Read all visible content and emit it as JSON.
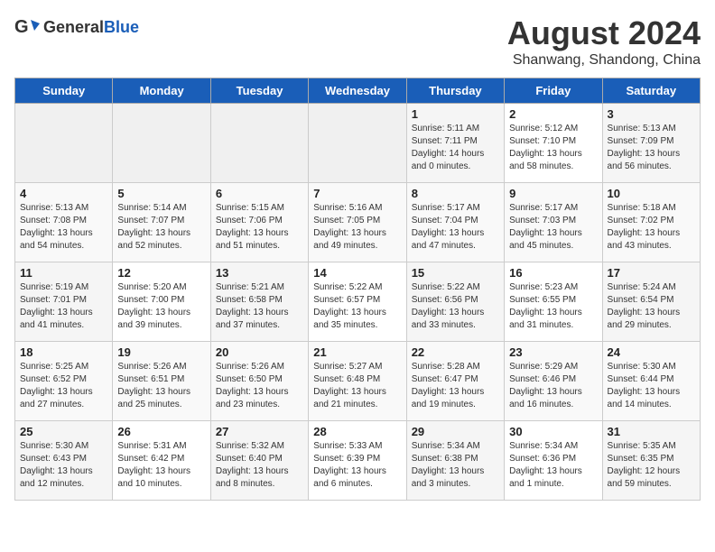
{
  "header": {
    "logo": {
      "general": "General",
      "blue": "Blue"
    },
    "title": "August 2024",
    "subtitle": "Shanwang, Shandong, China"
  },
  "weekdays": [
    "Sunday",
    "Monday",
    "Tuesday",
    "Wednesday",
    "Thursday",
    "Friday",
    "Saturday"
  ],
  "weeks": [
    [
      {
        "day": "",
        "info": ""
      },
      {
        "day": "",
        "info": ""
      },
      {
        "day": "",
        "info": ""
      },
      {
        "day": "",
        "info": ""
      },
      {
        "day": "1",
        "info": "Sunrise: 5:11 AM\nSunset: 7:11 PM\nDaylight: 14 hours\nand 0 minutes."
      },
      {
        "day": "2",
        "info": "Sunrise: 5:12 AM\nSunset: 7:10 PM\nDaylight: 13 hours\nand 58 minutes."
      },
      {
        "day": "3",
        "info": "Sunrise: 5:13 AM\nSunset: 7:09 PM\nDaylight: 13 hours\nand 56 minutes."
      }
    ],
    [
      {
        "day": "4",
        "info": "Sunrise: 5:13 AM\nSunset: 7:08 PM\nDaylight: 13 hours\nand 54 minutes."
      },
      {
        "day": "5",
        "info": "Sunrise: 5:14 AM\nSunset: 7:07 PM\nDaylight: 13 hours\nand 52 minutes."
      },
      {
        "day": "6",
        "info": "Sunrise: 5:15 AM\nSunset: 7:06 PM\nDaylight: 13 hours\nand 51 minutes."
      },
      {
        "day": "7",
        "info": "Sunrise: 5:16 AM\nSunset: 7:05 PM\nDaylight: 13 hours\nand 49 minutes."
      },
      {
        "day": "8",
        "info": "Sunrise: 5:17 AM\nSunset: 7:04 PM\nDaylight: 13 hours\nand 47 minutes."
      },
      {
        "day": "9",
        "info": "Sunrise: 5:17 AM\nSunset: 7:03 PM\nDaylight: 13 hours\nand 45 minutes."
      },
      {
        "day": "10",
        "info": "Sunrise: 5:18 AM\nSunset: 7:02 PM\nDaylight: 13 hours\nand 43 minutes."
      }
    ],
    [
      {
        "day": "11",
        "info": "Sunrise: 5:19 AM\nSunset: 7:01 PM\nDaylight: 13 hours\nand 41 minutes."
      },
      {
        "day": "12",
        "info": "Sunrise: 5:20 AM\nSunset: 7:00 PM\nDaylight: 13 hours\nand 39 minutes."
      },
      {
        "day": "13",
        "info": "Sunrise: 5:21 AM\nSunset: 6:58 PM\nDaylight: 13 hours\nand 37 minutes."
      },
      {
        "day": "14",
        "info": "Sunrise: 5:22 AM\nSunset: 6:57 PM\nDaylight: 13 hours\nand 35 minutes."
      },
      {
        "day": "15",
        "info": "Sunrise: 5:22 AM\nSunset: 6:56 PM\nDaylight: 13 hours\nand 33 minutes."
      },
      {
        "day": "16",
        "info": "Sunrise: 5:23 AM\nSunset: 6:55 PM\nDaylight: 13 hours\nand 31 minutes."
      },
      {
        "day": "17",
        "info": "Sunrise: 5:24 AM\nSunset: 6:54 PM\nDaylight: 13 hours\nand 29 minutes."
      }
    ],
    [
      {
        "day": "18",
        "info": "Sunrise: 5:25 AM\nSunset: 6:52 PM\nDaylight: 13 hours\nand 27 minutes."
      },
      {
        "day": "19",
        "info": "Sunrise: 5:26 AM\nSunset: 6:51 PM\nDaylight: 13 hours\nand 25 minutes."
      },
      {
        "day": "20",
        "info": "Sunrise: 5:26 AM\nSunset: 6:50 PM\nDaylight: 13 hours\nand 23 minutes."
      },
      {
        "day": "21",
        "info": "Sunrise: 5:27 AM\nSunset: 6:48 PM\nDaylight: 13 hours\nand 21 minutes."
      },
      {
        "day": "22",
        "info": "Sunrise: 5:28 AM\nSunset: 6:47 PM\nDaylight: 13 hours\nand 19 minutes."
      },
      {
        "day": "23",
        "info": "Sunrise: 5:29 AM\nSunset: 6:46 PM\nDaylight: 13 hours\nand 16 minutes."
      },
      {
        "day": "24",
        "info": "Sunrise: 5:30 AM\nSunset: 6:44 PM\nDaylight: 13 hours\nand 14 minutes."
      }
    ],
    [
      {
        "day": "25",
        "info": "Sunrise: 5:30 AM\nSunset: 6:43 PM\nDaylight: 13 hours\nand 12 minutes."
      },
      {
        "day": "26",
        "info": "Sunrise: 5:31 AM\nSunset: 6:42 PM\nDaylight: 13 hours\nand 10 minutes."
      },
      {
        "day": "27",
        "info": "Sunrise: 5:32 AM\nSunset: 6:40 PM\nDaylight: 13 hours\nand 8 minutes."
      },
      {
        "day": "28",
        "info": "Sunrise: 5:33 AM\nSunset: 6:39 PM\nDaylight: 13 hours\nand 6 minutes."
      },
      {
        "day": "29",
        "info": "Sunrise: 5:34 AM\nSunset: 6:38 PM\nDaylight: 13 hours\nand 3 minutes."
      },
      {
        "day": "30",
        "info": "Sunrise: 5:34 AM\nSunset: 6:36 PM\nDaylight: 13 hours\nand 1 minute."
      },
      {
        "day": "31",
        "info": "Sunrise: 5:35 AM\nSunset: 6:35 PM\nDaylight: 12 hours\nand 59 minutes."
      }
    ]
  ]
}
